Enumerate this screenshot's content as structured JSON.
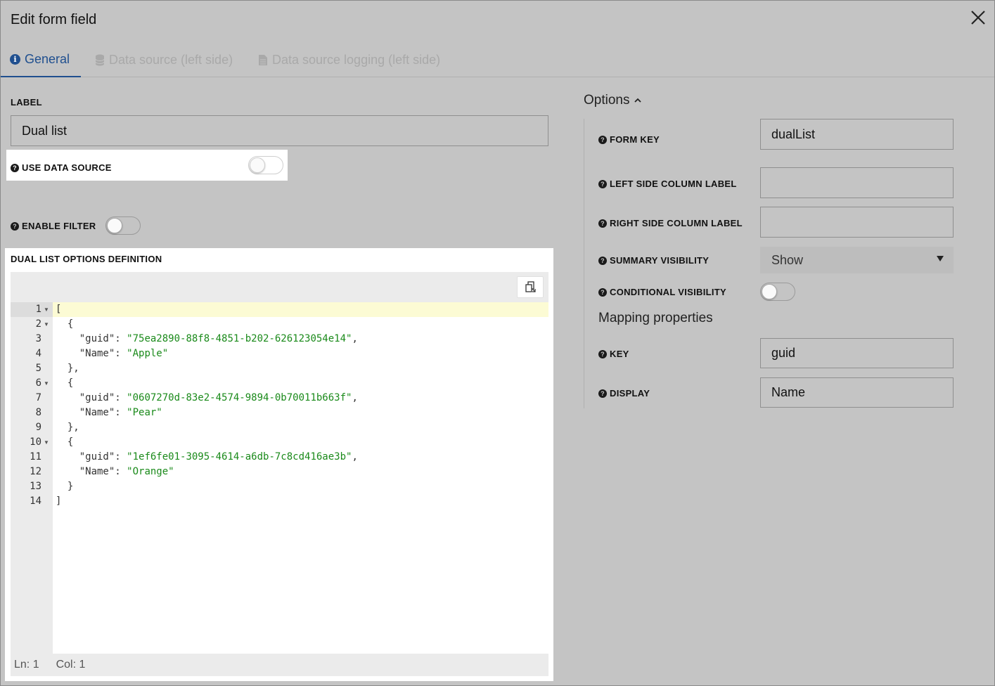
{
  "dialog": {
    "title": "Edit form field"
  },
  "tabs": [
    {
      "label": "General",
      "icon": "info-icon",
      "state": "active"
    },
    {
      "label": "Data source (left side)",
      "icon": "database-icon",
      "state": "disabled"
    },
    {
      "label": "Data source logging (left side)",
      "icon": "file-icon",
      "state": "disabled"
    }
  ],
  "left": {
    "label_heading": "LABEL",
    "label_value": "Dual list",
    "use_data_source_label": "USE DATA SOURCE",
    "use_data_source_on": false,
    "enable_filter_label": "ENABLE FILTER",
    "enable_filter_on": false,
    "options_definition_heading": "DUAL LIST OPTIONS DEFINITION"
  },
  "editor": {
    "lines": [
      {
        "n": "1",
        "fold": true,
        "text": "["
      },
      {
        "n": "2",
        "fold": true,
        "text": "  {"
      },
      {
        "n": "3",
        "fold": false,
        "key": "    \"guid\": ",
        "str": "\"75ea2890-88f8-4851-b202-626123054e14\"",
        "tail": ","
      },
      {
        "n": "4",
        "fold": false,
        "key": "    \"Name\": ",
        "str": "\"Apple\"",
        "tail": ""
      },
      {
        "n": "5",
        "fold": false,
        "text": "  },"
      },
      {
        "n": "6",
        "fold": true,
        "text": "  {"
      },
      {
        "n": "7",
        "fold": false,
        "key": "    \"guid\": ",
        "str": "\"0607270d-83e2-4574-9894-0b70011b663f\"",
        "tail": ","
      },
      {
        "n": "8",
        "fold": false,
        "key": "    \"Name\": ",
        "str": "\"Pear\"",
        "tail": ""
      },
      {
        "n": "9",
        "fold": false,
        "text": "  },"
      },
      {
        "n": "10",
        "fold": true,
        "text": "  {"
      },
      {
        "n": "11",
        "fold": false,
        "key": "    \"guid\": ",
        "str": "\"1ef6fe01-3095-4614-a6db-7c8cd416ae3b\"",
        "tail": ","
      },
      {
        "n": "12",
        "fold": false,
        "key": "    \"Name\": ",
        "str": "\"Orange\"",
        "tail": ""
      },
      {
        "n": "13",
        "fold": false,
        "text": "  }"
      },
      {
        "n": "14",
        "fold": false,
        "text": "]"
      }
    ],
    "status_ln": "Ln: 1",
    "status_col": "Col: 1"
  },
  "options": {
    "heading": "Options",
    "form_key_label": "FORM KEY",
    "form_key_value": "dualList",
    "left_col_label": "LEFT SIDE COLUMN LABEL",
    "left_col_value": "",
    "right_col_label": "RIGHT SIDE COLUMN LABEL",
    "right_col_value": "",
    "summary_visibility_label": "SUMMARY VISIBILITY",
    "summary_visibility_value": "Show",
    "conditional_visibility_label": "CONDITIONAL VISIBILITY",
    "conditional_visibility_on": false,
    "mapping_heading": "Mapping properties",
    "key_label": "KEY",
    "key_value": "guid",
    "display_label": "DISPLAY",
    "display_value": "Name"
  },
  "colors": {
    "accent": "#1f4f8f",
    "string": "#1a8a1a",
    "active_line": "#fcfbd4",
    "overlay": "#c4c4c4"
  }
}
